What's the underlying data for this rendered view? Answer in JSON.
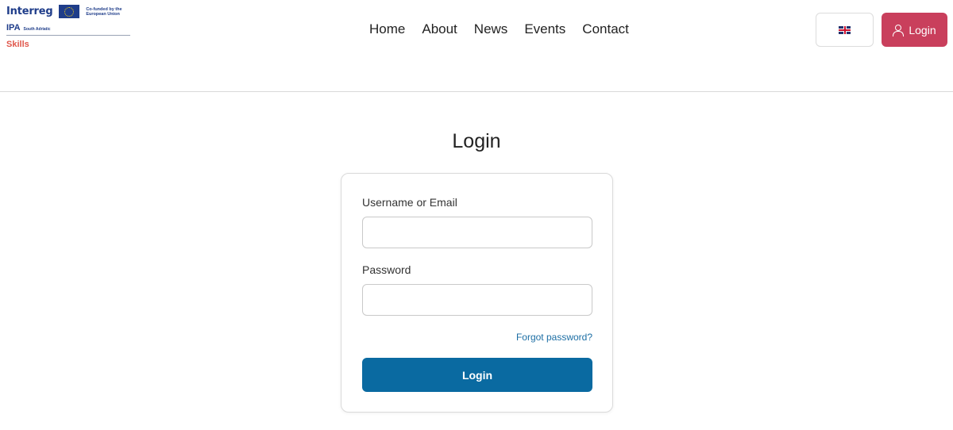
{
  "header": {
    "logo": {
      "brand": "Interreg",
      "cofunded": "Co-funded by the European Union",
      "program": "IPA",
      "region": "South Adriatic",
      "project": "Skills"
    },
    "nav": [
      "Home",
      "About",
      "News",
      "Events",
      "Contact"
    ],
    "language_icon": "uk-flag-icon",
    "login_label": "Login",
    "login_icon": "user-icon"
  },
  "main": {
    "title": "Login",
    "form": {
      "username_label": "Username or Email",
      "username_value": "",
      "password_label": "Password",
      "password_value": "",
      "forgot_label": "Forgot password?",
      "submit_label": "Login"
    }
  },
  "colors": {
    "accent_login": "#c93f5c",
    "primary_button": "#0a6aa1",
    "link": "#1c6ea4",
    "brand_blue": "#1f3d8a",
    "brand_red": "#e0564a"
  }
}
